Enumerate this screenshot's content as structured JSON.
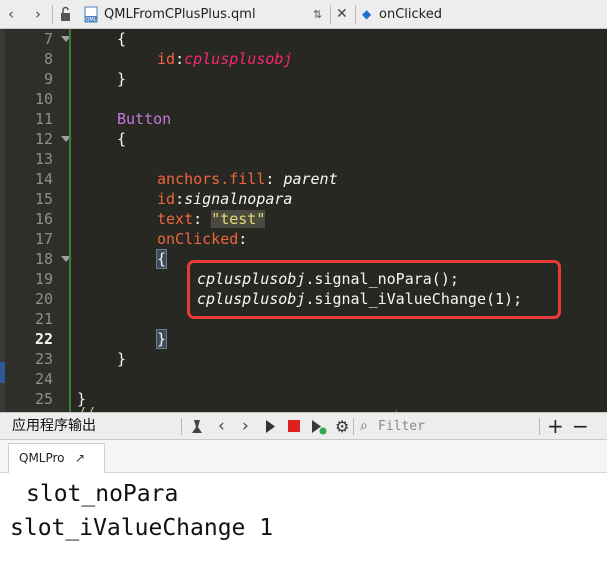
{
  "toolbar": {
    "file_name": "QMLFromCPlusPlus.qml",
    "symbol": "onClicked"
  },
  "editor": {
    "current_line": 22,
    "line_numbers": [
      "7",
      "8",
      "9",
      "10",
      "11",
      "12",
      "13",
      "14",
      "15",
      "16",
      "17",
      "18",
      "19",
      "20",
      "21",
      "22",
      "23",
      "24",
      "25"
    ],
    "lines": {
      "l7": "{",
      "l8_prop": "id",
      "l8_val": "cplusplusobj",
      "l9": "}",
      "l11": "Button",
      "l12": "{",
      "l14_prop": "anchors.fill",
      "l14_val": "parent",
      "l15_prop": "id",
      "l15_val": "signalnopara",
      "l16_prop": "text",
      "l16_val": "\"test\"",
      "l17_prop": "onClicked",
      "l18": "{",
      "l19_obj": "cplusplusobj",
      "l19_rest": ".signal_noPara();",
      "l20_obj": "cplusplusobj",
      "l20_rest": ".signal_iValueChange(1);",
      "l22": "}",
      "l23": "}",
      "l25": "}"
    },
    "cut_line": "//...  ...  ...  ...  ...  ...  ...()"
  },
  "output_pane": {
    "title": "应用程序输出",
    "filter_placeholder": "Filter",
    "tab_label": "QMLPro",
    "lines": [
      "slot_noPara",
      "slot_iValueChange 1"
    ]
  },
  "colors": {
    "keyword": "#c678dd",
    "property": "#f0653f",
    "identifier": "#f92672",
    "string": "#e6db74",
    "highlight_box": "#e83a3a"
  }
}
